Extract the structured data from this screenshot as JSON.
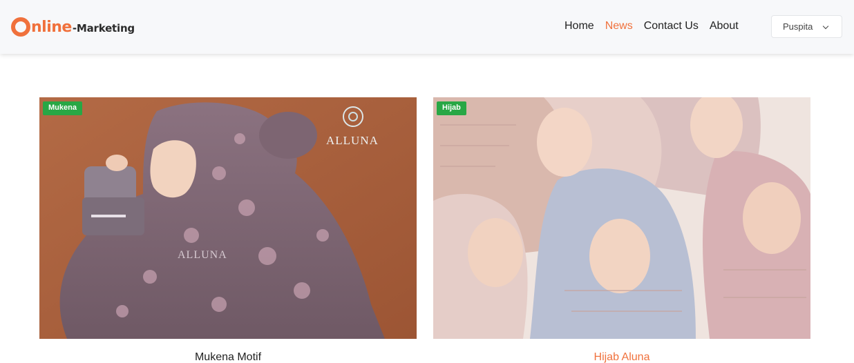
{
  "brand": {
    "text_main": "nline",
    "text_sub": "-Marketing",
    "accent_color": "#f0713c",
    "icon": "logo-o-ring"
  },
  "nav": {
    "items": [
      {
        "label": "Home",
        "active": false
      },
      {
        "label": "News",
        "active": true
      },
      {
        "label": "Contact Us",
        "active": false
      },
      {
        "label": "About",
        "active": false
      }
    ]
  },
  "user_menu": {
    "name": "Puspita",
    "icon": "chevron-down-icon"
  },
  "posts": [
    {
      "category": "Mukena",
      "title": "Mukena Motif",
      "image_brand_text": "ALLUNA",
      "badge_color": "#28a745"
    },
    {
      "category": "Hijab",
      "title": "Hijab Aluna",
      "badge_color": "#28a745"
    }
  ]
}
